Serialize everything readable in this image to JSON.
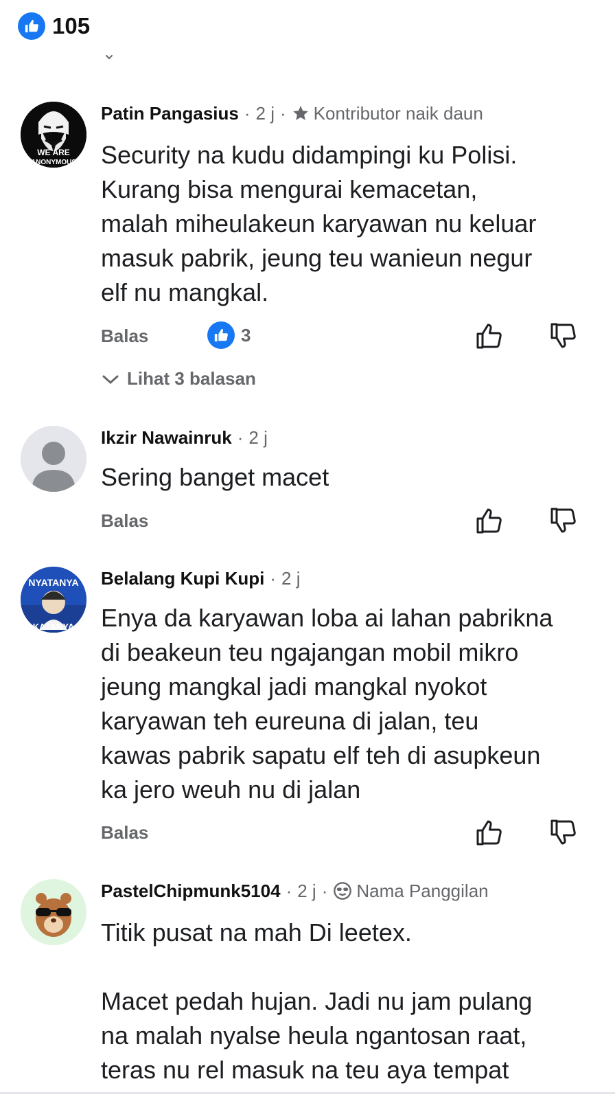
{
  "header": {
    "like_count": "105",
    "like_icon": "thumbs-up-icon"
  },
  "comments": [
    {
      "author": "Patin Pangasius",
      "time": "2 j",
      "badge": "Kontributor naik daun",
      "badge_icon": "star-icon",
      "avatar_text_1": "WE ARE",
      "avatar_text_2": "ANONYMOUS",
      "text": "Security na kudu didampingi ku Polisi.\nKurang bisa mengurai kemacetan,\nmalah miheulakeun karyawan nu keluar\nmasuk pabrik, jeung teu wanieun negur\nelf nu mangkal.",
      "reply_label": "Balas",
      "reaction_count": "3",
      "view_replies": "Lihat 3 balasan"
    },
    {
      "author": "Ikzir Nawainruk",
      "time": "2 j",
      "text": "Sering banget macet",
      "reply_label": "Balas"
    },
    {
      "author": "Belalang Kupi Kupi",
      "time": "2 j",
      "avatar_text_1": "NYATANYA",
      "avatar_text_2": "KATANYA",
      "text": "Enya da karyawan loba ai lahan pabrikna\ndi beakeun teu ngajangan mobil mikro\njeung mangkal jadi mangkal nyokot\nkaryawan teh eureuna di jalan, teu\nkawas pabrik sapatu elf teh di asupkeun\nka jero weuh nu di jalan",
      "reply_label": "Balas"
    },
    {
      "author": "PastelChipmunk5104",
      "time": "2 j",
      "badge": "Nama Panggilan",
      "badge_icon": "sunglasses-face-icon",
      "text": "Titik pusat na mah Di leetex.\n\nMacet pedah hujan. Jadi nu jam pulang\nna malah nyalse heula ngantosan raat,\nteras nu rel masuk na teu aya tempat"
    }
  ],
  "colors": {
    "accent": "#1877f2",
    "muted": "#65676b",
    "text": "#1c1e21"
  }
}
